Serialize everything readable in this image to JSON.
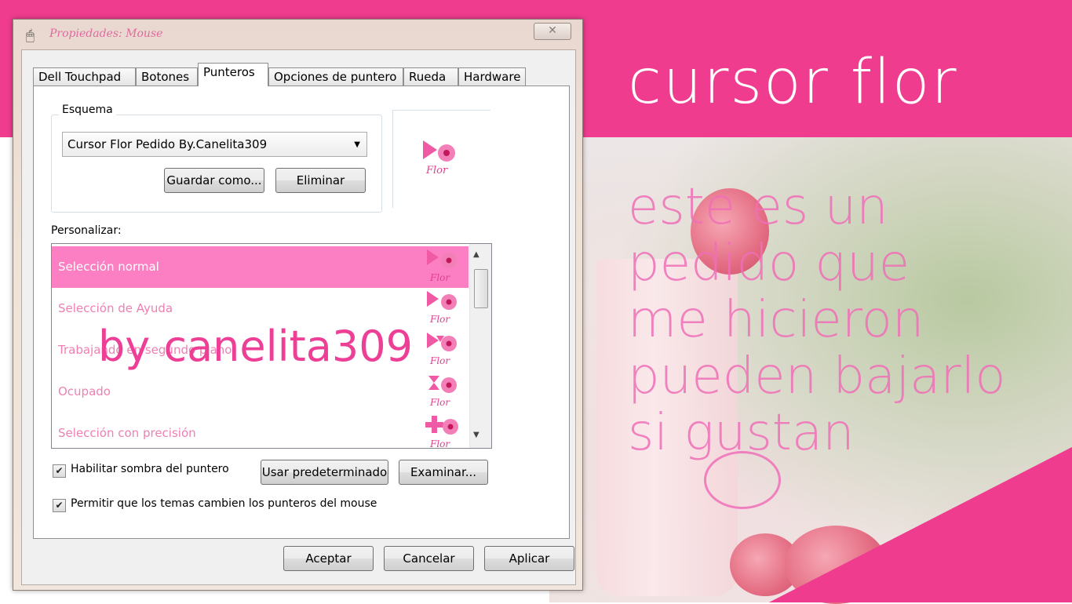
{
  "window": {
    "title": "Propiedades: Mouse",
    "close_glyph": "✕"
  },
  "tabs": [
    "Dell Touchpad",
    "Botones",
    "Punteros",
    "Opciones de puntero",
    "Rueda",
    "Hardware"
  ],
  "active_tab": "Punteros",
  "scheme": {
    "group_label": "Esquema",
    "selected": "Cursor Flor Pedido By.Canelita309",
    "save_label": "Guardar como...",
    "delete_label": "Eliminar"
  },
  "customize": {
    "label": "Personalizar:",
    "items": [
      {
        "label": "Selección normal",
        "icon": "arrow-flower-icon"
      },
      {
        "label": "Selección de Ayuda",
        "icon": "help-flower-icon"
      },
      {
        "label": "Trabajando en segundo plano",
        "icon": "busy-arrow-flower-icon"
      },
      {
        "label": "Ocupado",
        "icon": "hourglass-flower-icon"
      },
      {
        "label": "Selección con precisión",
        "icon": "crosshair-flower-icon"
      }
    ],
    "icon_text": "Flor"
  },
  "options": {
    "shadow_label": "Habilitar sombra del puntero",
    "shadow_checked": true,
    "themes_label": "Permitir que los temas cambien los punteros del mouse",
    "themes_checked": true,
    "default_label": "Usar predeterminado",
    "browse_label": "Examinar..."
  },
  "footer": {
    "ok_label": "Aceptar",
    "cancel_label": "Cancelar",
    "apply_label": "Aplicar"
  },
  "overlay": {
    "title": "cursor flor",
    "message_lines": [
      "este es un",
      "pedido que",
      "me hicieron",
      "pueden bajarlo",
      "si  gustan"
    ],
    "byline": "by canelita309"
  },
  "colors": {
    "brand_pink": "#f03c8f",
    "selection_pink": "#fb7fc2",
    "text_pink": "#ee80b3"
  }
}
